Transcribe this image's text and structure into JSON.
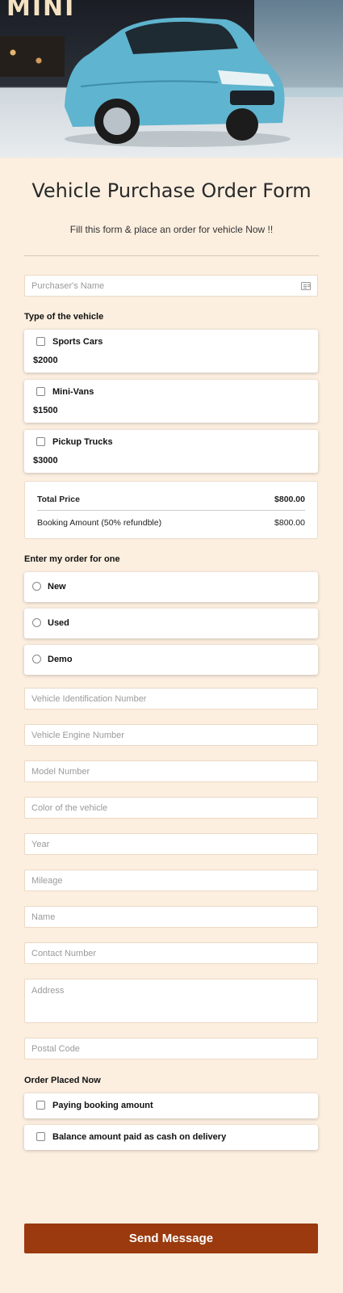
{
  "hero": {
    "sign_text": "MINI"
  },
  "header": {
    "title": "Vehicle Purchase Order Form",
    "subtitle": "Fill this form & place an order for vehicle Now !!"
  },
  "purchaser": {
    "placeholder": "Purchaser's Name"
  },
  "vehicle_type": {
    "label": "Type of the vehicle",
    "options": [
      {
        "label": "Sports Cars",
        "price": "$2000",
        "checked": false
      },
      {
        "label": "Mini-Vans",
        "price": "$1500",
        "checked": false
      },
      {
        "label": "Pickup Trucks",
        "price": "$3000",
        "checked": false
      }
    ]
  },
  "summary": {
    "total_label": "Total Price",
    "total_value": "$800.00",
    "booking_label": "Booking Amount (50% refundble)",
    "booking_value": "$800.00"
  },
  "order_for": {
    "label": "Enter my order for one",
    "options": [
      "New",
      "Used",
      "Demo"
    ]
  },
  "fields": {
    "vin": "Vehicle Identification Number",
    "engine": "Vehicle Engine Number",
    "model": "Model Number",
    "color": "Color of the vehicle",
    "year": "Year",
    "mileage": "Mileage",
    "name": "Name",
    "contact": "Contact Number",
    "address": "Address",
    "postal": "Postal Code"
  },
  "order_placed": {
    "label": "Order Placed Now",
    "options": [
      "Paying booking amount",
      "Balance amount paid as cash on delivery"
    ]
  },
  "submit": {
    "label": "Send Message"
  },
  "colors": {
    "background": "#fcefe0",
    "button": "#9a3a0e",
    "car": "#5fb4cf"
  }
}
